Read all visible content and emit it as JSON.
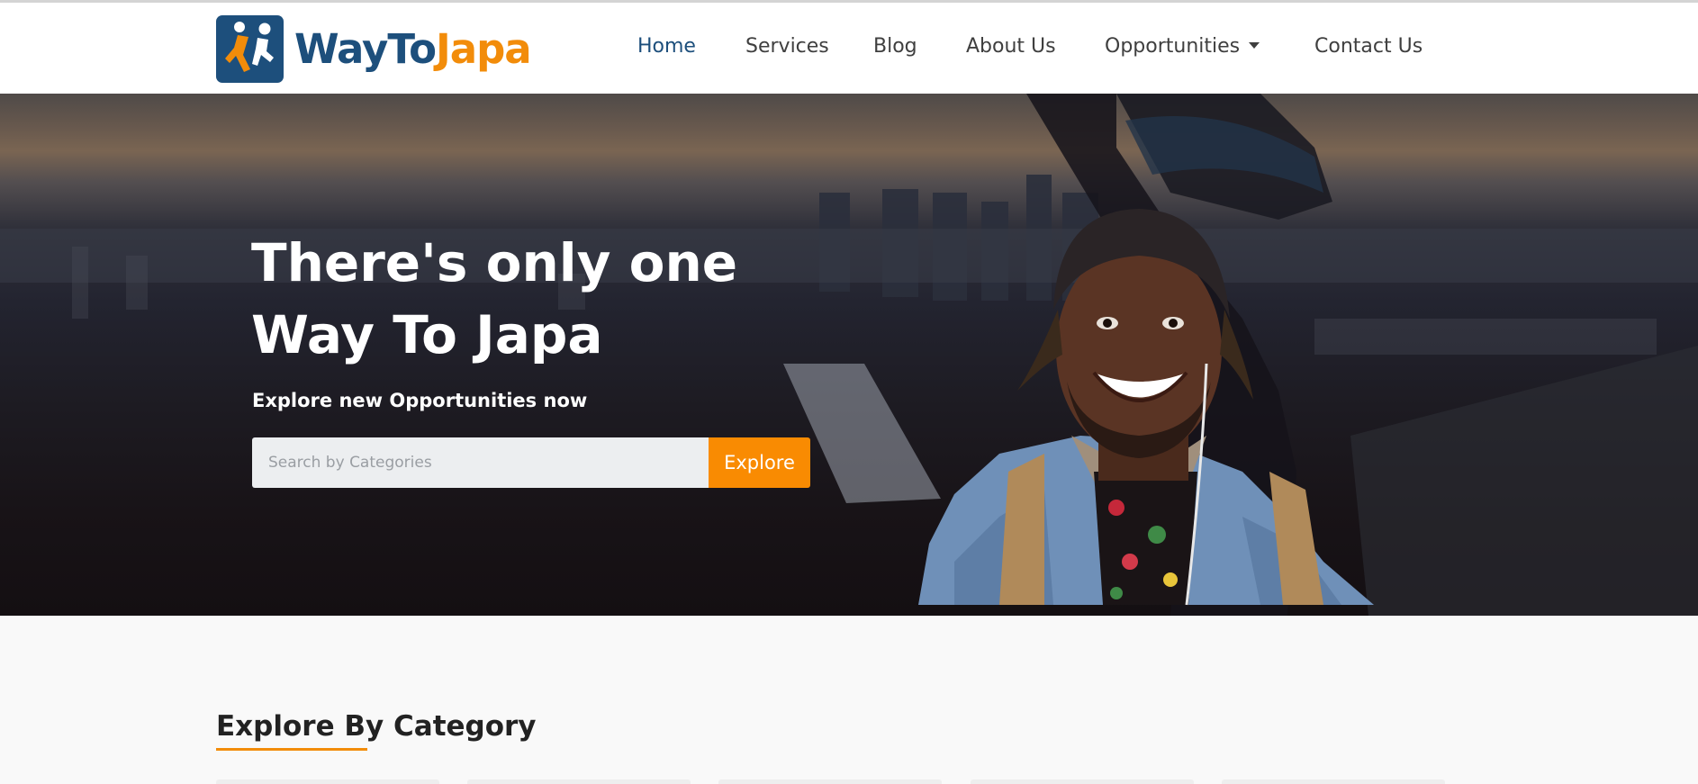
{
  "brand": {
    "name_part1": "WayTo",
    "name_part2": "Japa",
    "colors": {
      "primary": "#1d4f7c",
      "accent": "#f28c0a",
      "button": "#f98b02"
    }
  },
  "nav": {
    "items": [
      {
        "label": "Home",
        "active": true
      },
      {
        "label": "Services"
      },
      {
        "label": "Blog"
      },
      {
        "label": "About Us"
      },
      {
        "label": "Opportunities",
        "has_dropdown": true
      },
      {
        "label": "Contact Us"
      }
    ]
  },
  "hero": {
    "title_line1": "There's only one",
    "title_line2": "Way To Japa",
    "subtitle": "Explore new Opportunities now",
    "search": {
      "placeholder": "Search by Categories",
      "value": "",
      "button_label": "Explore"
    }
  },
  "category_section": {
    "title": "Explore By Category"
  }
}
